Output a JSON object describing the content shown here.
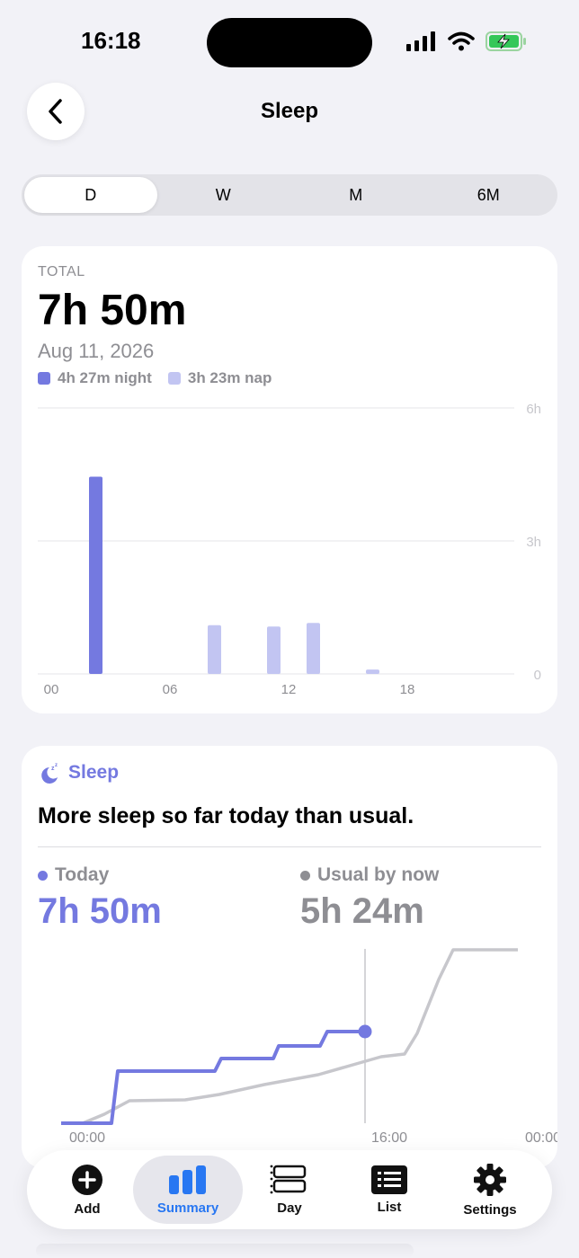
{
  "status": {
    "time": "16:18"
  },
  "nav": {
    "title": "Sleep"
  },
  "segments": [
    "D",
    "W",
    "M",
    "6M"
  ],
  "summary": {
    "total_label": "TOTAL",
    "total_value": "7h 50m",
    "date": "Aug 11, 2026",
    "legend": [
      {
        "label": "4h 27m night",
        "color": "#7479e0"
      },
      {
        "label": "3h 23m nap",
        "color": "#c2c5f2"
      }
    ]
  },
  "chart_data": {
    "type": "bar",
    "x_tick_labels": [
      "00",
      "06",
      "12",
      "18"
    ],
    "y_tick_labels": [
      "6h",
      "3h",
      "0"
    ],
    "ylim": [
      0,
      6
    ],
    "series": [
      {
        "name": "night",
        "color": "#7479e0",
        "points": [
          {
            "hour": 2.5,
            "hours": 4.45
          }
        ]
      },
      {
        "name": "nap",
        "color": "#c2c5f2",
        "points": [
          {
            "hour": 8.5,
            "hours": 1.1
          },
          {
            "hour": 11.5,
            "hours": 1.07
          },
          {
            "hour": 13.5,
            "hours": 1.15
          },
          {
            "hour": 16.5,
            "hours": 0.1
          }
        ]
      }
    ]
  },
  "insight": {
    "header": "Sleep",
    "title": "More sleep so far today than usual.",
    "today_label": "Today",
    "today_value": "7h 50m",
    "usual_label": "Usual by now",
    "usual_value": "5h 24m",
    "x_tick_labels": [
      "00:00",
      "16:00",
      "00:00"
    ]
  },
  "tabs": [
    {
      "label": "Add",
      "icon": "add-icon"
    },
    {
      "label": "Summary",
      "icon": "summary-icon"
    },
    {
      "label": "Day",
      "icon": "day-icon"
    },
    {
      "label": "List",
      "icon": "list-icon"
    },
    {
      "label": "Settings",
      "icon": "settings-icon"
    }
  ],
  "colors": {
    "accent": "#7479e0",
    "nap": "#c2c5f2",
    "usual": "#c7c7cc",
    "tab_active": "#2877f2"
  }
}
